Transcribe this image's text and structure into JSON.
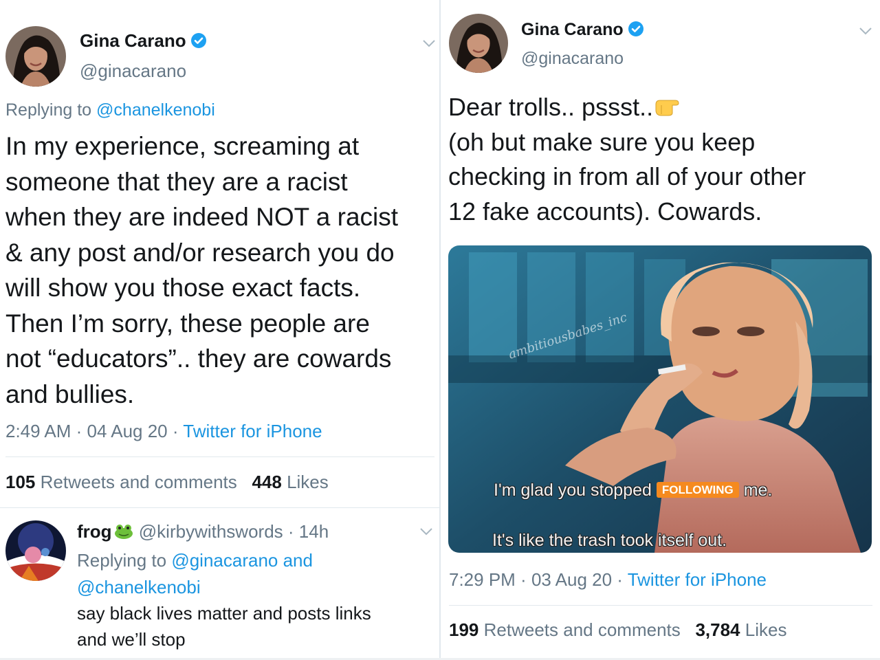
{
  "left_tweet": {
    "author": {
      "name": "Gina Carano",
      "handle": "@ginacarano"
    },
    "replying_prefix": "Replying to ",
    "replying_to": "@chanelkenobi",
    "body_lines": [
      "In my experience, screaming at",
      "someone that they are a racist",
      "when they are indeed NOT a racist",
      "& any post and/or research you do",
      "will show you those exact facts.",
      "Then I’m sorry, these people are",
      "not “educators”.. they are cowards",
      "and bullies."
    ],
    "time": "2:49 AM",
    "date": "04 Aug 20",
    "source": "Twitter for iPhone",
    "retweets_count": "105",
    "retweets_label": "Retweets and comments",
    "likes_count": "448",
    "likes_label": "Likes"
  },
  "reply_tweet": {
    "author": {
      "name": "frog",
      "handle": "@kirbywithswords",
      "age": "14h"
    },
    "replying_prefix": "Replying to ",
    "replying_to_1": "@ginacarano",
    "replying_and": " and",
    "replying_to_2": "@chanelkenobi",
    "body_lines": [
      "say black lives matter and posts links",
      "and we’ll stop"
    ]
  },
  "right_tweet": {
    "author": {
      "name": "Gina Carano",
      "handle": "@ginacarano"
    },
    "body_lines": [
      "Dear trolls.. pssst..",
      "(oh but make sure you keep",
      "checking in from all of your other",
      "12 fake accounts). Cowards."
    ],
    "image": {
      "watermark": "ambitiousbabes_inc",
      "caption_line1_prefix": "I'm glad you stopped",
      "caption_badge": "FOLLOWING",
      "caption_line1_suffix": "me.",
      "caption_line2": "It's like the trash took itself out."
    },
    "time": "7:29 PM",
    "date": "03 Aug 20",
    "source": "Twitter for iPhone",
    "retweets_count": "199",
    "retweets_label": "Retweets and comments",
    "likes_count": "3,784",
    "likes_label": "Likes"
  },
  "colors": {
    "link": "#1b95e0",
    "secondary_text": "#657786",
    "verified": "#1da1f2",
    "badge": "#f58a1f"
  },
  "icons": [
    "verified-badge-icon",
    "chevron-down-icon",
    "frog-emoji-icon",
    "pointing-right-emoji-icon"
  ]
}
